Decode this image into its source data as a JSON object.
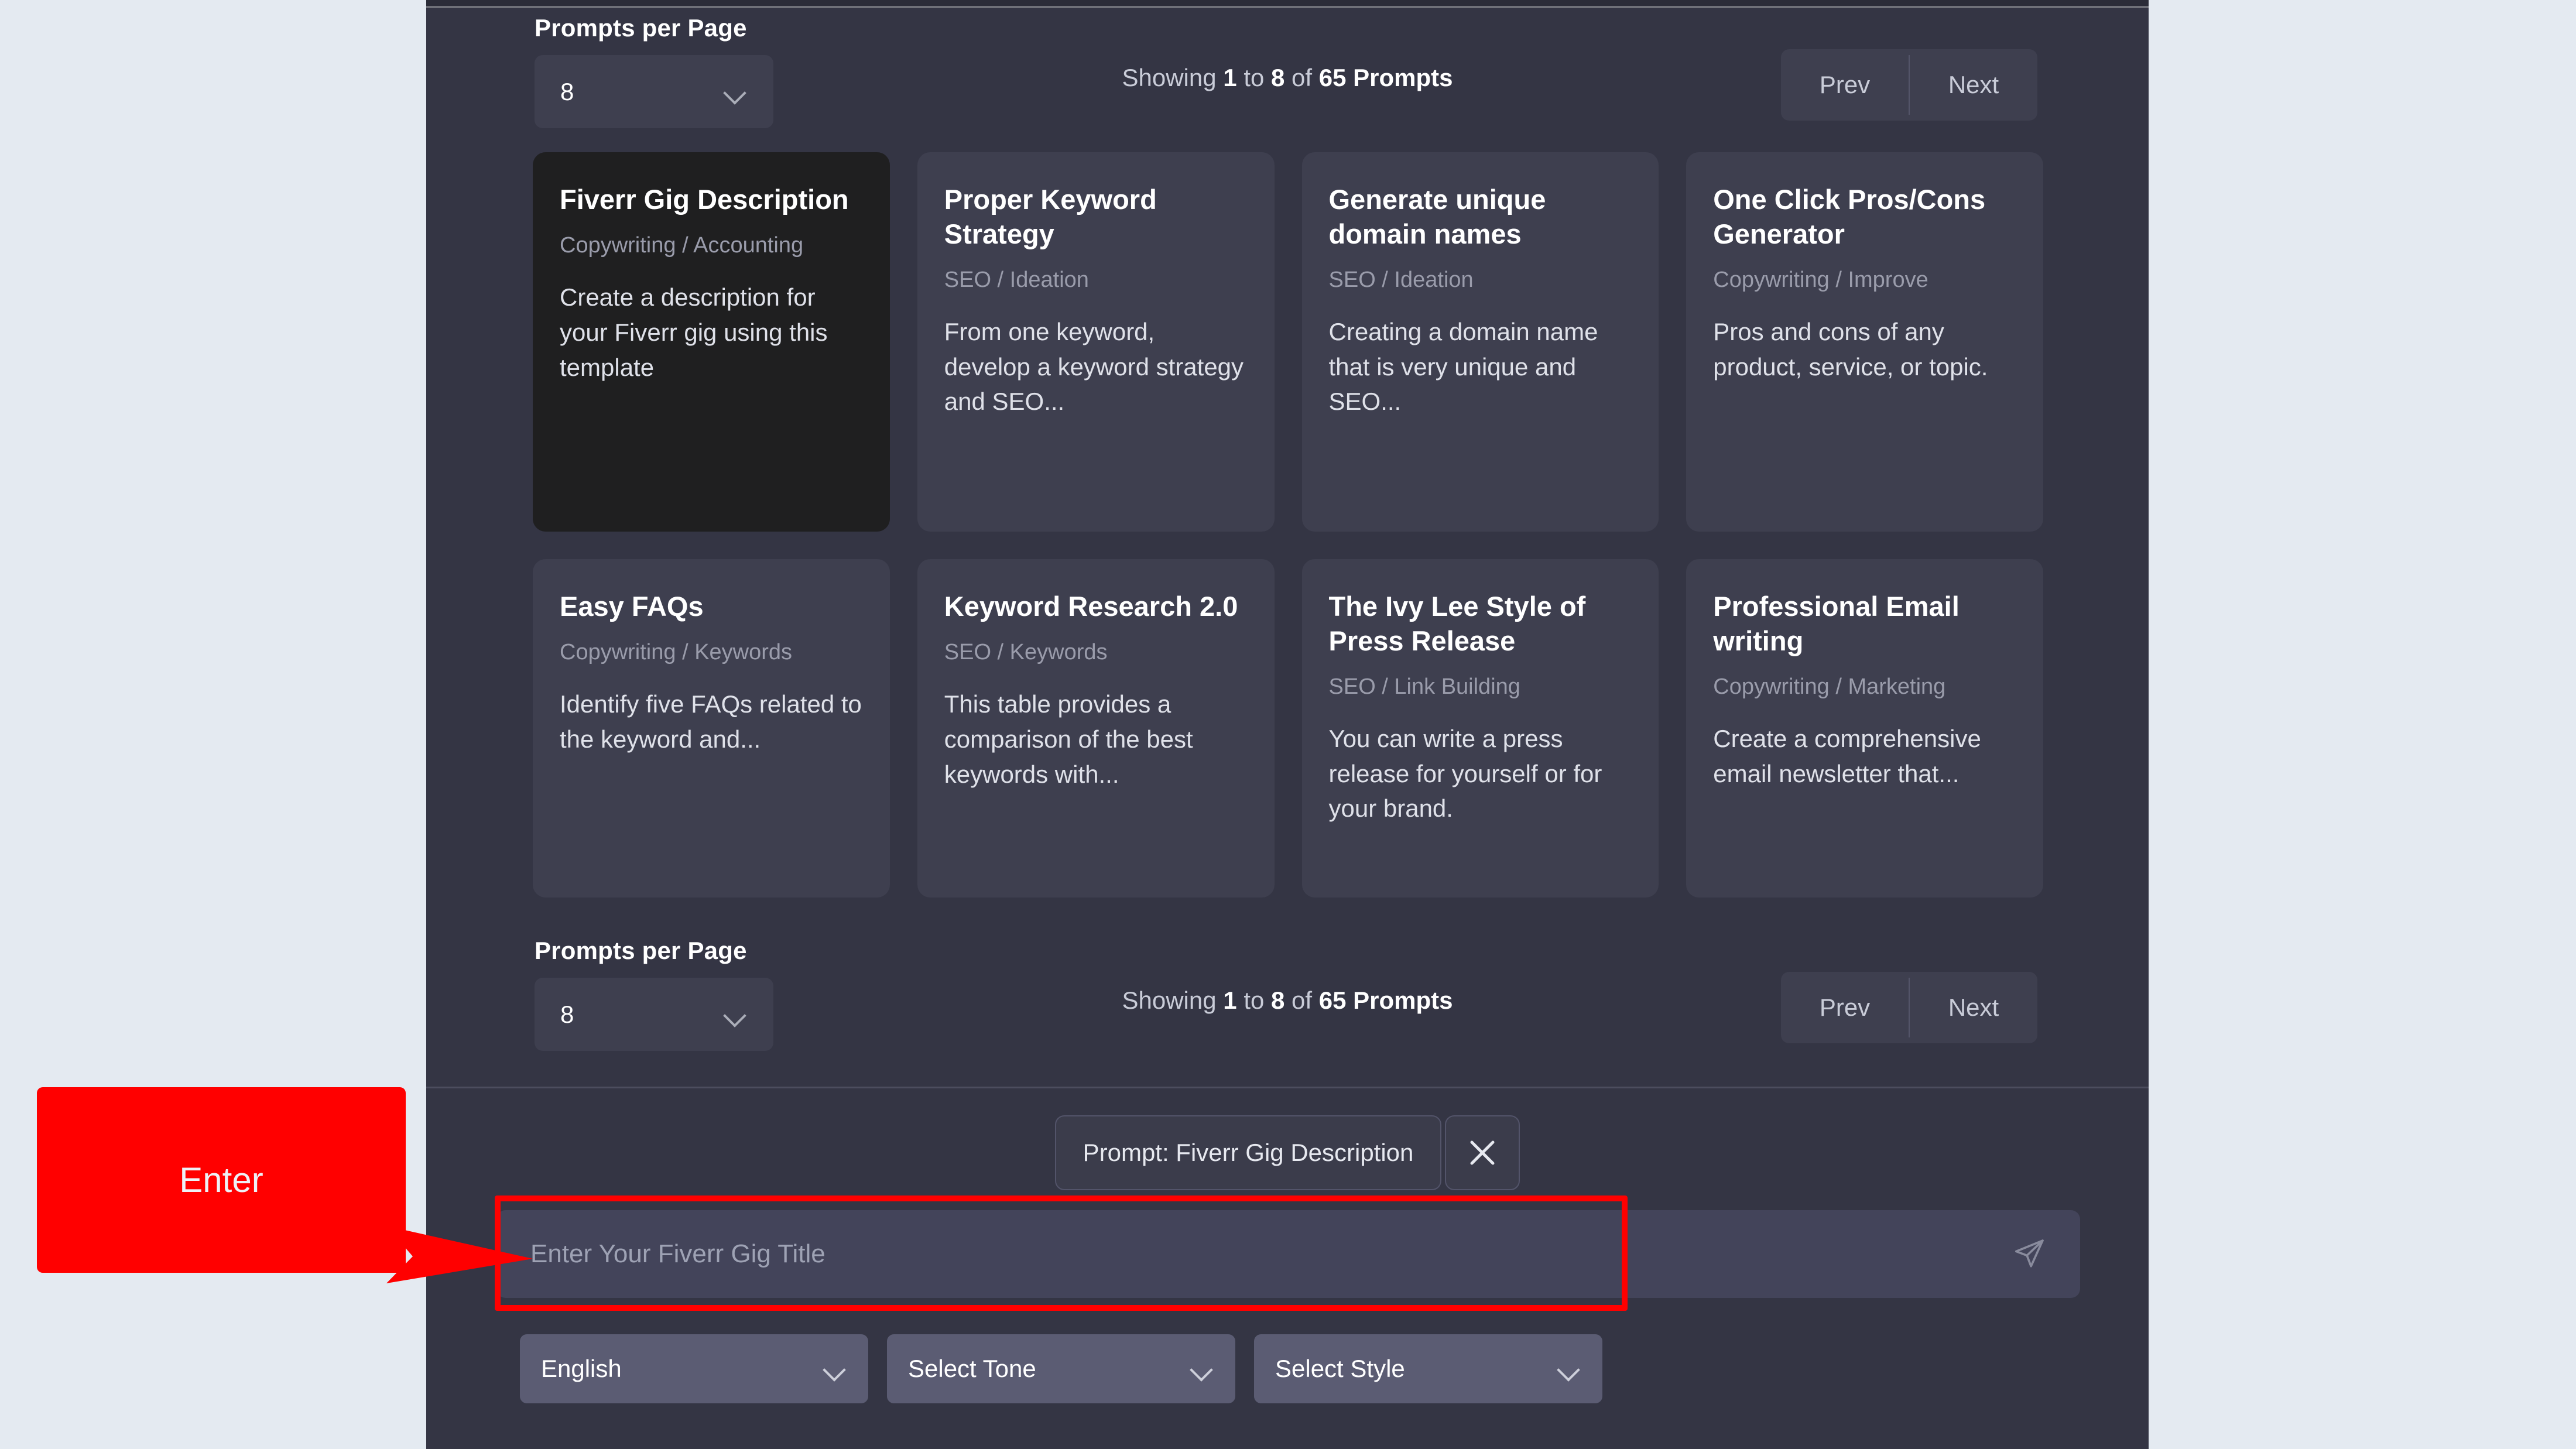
{
  "pagination": {
    "per_page_label": "Prompts per Page",
    "per_page_value": "8",
    "showing_prefix": "Showing",
    "showing_from": "1",
    "showing_mid": "to",
    "showing_to": "8",
    "showing_of": "of",
    "showing_total": "65 Prompts",
    "prev_label": "Prev",
    "next_label": "Next"
  },
  "cards": [
    {
      "title": "Fiverr Gig Description",
      "category": "Copywriting / Accounting",
      "description": "Create a description for your Fiverr gig using this template",
      "selected": true
    },
    {
      "title": "Proper Keyword Strategy",
      "category": "SEO / Ideation",
      "description": "From one keyword, develop a keyword strategy and SEO...",
      "selected": false
    },
    {
      "title": "Generate unique domain names",
      "category": "SEO / Ideation",
      "description": "Creating a domain name that is very unique and SEO...",
      "selected": false
    },
    {
      "title": "One Click Pros/Cons Generator",
      "category": "Copywriting / Improve",
      "description": "Pros and cons of any product, service, or topic.",
      "selected": false
    },
    {
      "title": "Easy FAQs",
      "category": "Copywriting / Keywords",
      "description": "Identify five FAQs related to the keyword and...",
      "selected": false
    },
    {
      "title": "Keyword Research 2.0",
      "category": "SEO / Keywords",
      "description": "This table provides a comparison of the best keywords with...",
      "selected": false
    },
    {
      "title": "The Ivy Lee Style of Press Release",
      "category": "SEO / Link Building",
      "description": "You can write a press release for yourself or for your brand.",
      "selected": false
    },
    {
      "title": "Professional Email writing",
      "category": "Copywriting / Marketing",
      "description": "Create a comprehensive email newsletter that...",
      "selected": false
    }
  ],
  "composer": {
    "chip_label": "Prompt: Fiverr Gig Description",
    "close_icon": "close-icon",
    "input_placeholder": "Enter Your Fiverr Gig Title",
    "input_value": "",
    "send_icon": "send-icon",
    "selects": [
      {
        "value": "English"
      },
      {
        "value": "Select Tone"
      },
      {
        "value": "Select Style"
      }
    ]
  },
  "annotation": {
    "label": "Enter",
    "color": "#ff0000"
  }
}
